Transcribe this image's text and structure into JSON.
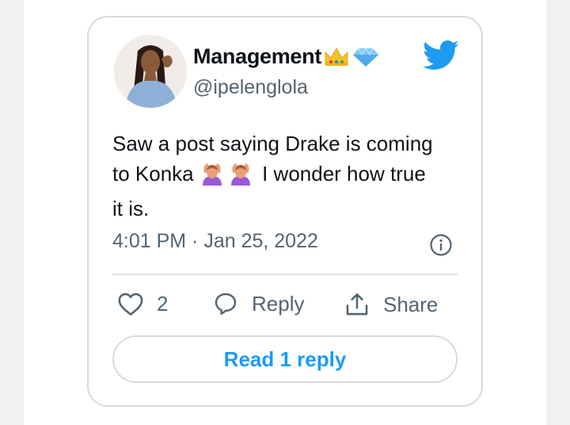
{
  "tweet": {
    "display_name": "Management",
    "name_emojis": [
      "crown-emoji",
      "gem-emoji"
    ],
    "handle": "@ipelenglola",
    "text_lines": [
      "Saw a post saying Drake is coming",
      "to Konka",
      "I wonder how true",
      "it is."
    ],
    "text_emojis": [
      "person-gesturing-ok-emoji",
      "person-gesturing-ok-emoji"
    ],
    "timestamp": "4:01 PM · Jan 25, 2022",
    "likes_count": "2",
    "reply_label": "Reply",
    "share_label": "Share",
    "read_replies_label": "Read 1 reply"
  },
  "colors": {
    "accent": "#1d9bf0",
    "text_primary": "#0f1419",
    "text_secondary": "#536471",
    "border": "#d6dbe0"
  }
}
